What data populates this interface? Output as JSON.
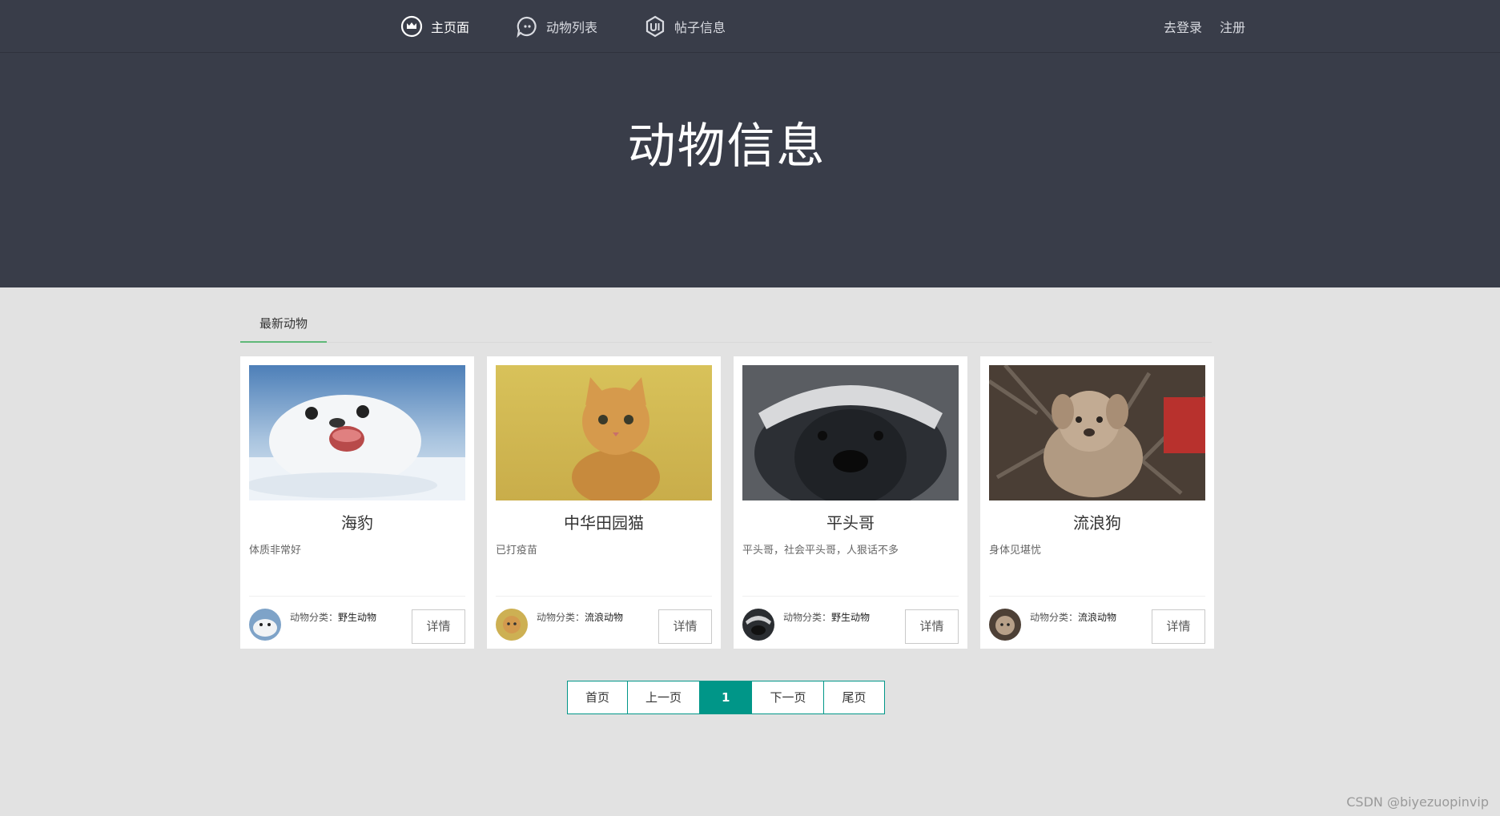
{
  "nav": {
    "items": [
      {
        "label": "主页面",
        "icon": "crown-icon",
        "active": true
      },
      {
        "label": "动物列表",
        "icon": "chat-icon",
        "active": false
      },
      {
        "label": "帖子信息",
        "icon": "ui-badge-icon",
        "active": false
      }
    ],
    "login_label": "去登录",
    "register_label": "注册"
  },
  "banner": {
    "title": "动物信息"
  },
  "section": {
    "tab_label": "最新动物"
  },
  "cards": [
    {
      "name": "海豹",
      "desc": "体质非常好",
      "category_prefix": "动物分类：",
      "category": "野生动物",
      "detail_label": "详情",
      "image": "seal-photo"
    },
    {
      "name": "中华田园猫",
      "desc": "已打疫苗",
      "category_prefix": "动物分类：",
      "category": "流浪动物",
      "detail_label": "详情",
      "image": "kitten-photo"
    },
    {
      "name": "平头哥",
      "desc": "平头哥，社会平头哥，人狠话不多",
      "category_prefix": "动物分类：",
      "category": "野生动物",
      "detail_label": "详情",
      "image": "honey-badger-photo"
    },
    {
      "name": "流浪狗",
      "desc": "身体见堪忧",
      "category_prefix": "动物分类：",
      "category": "流浪动物",
      "detail_label": "详情",
      "image": "stray-dog-photo"
    }
  ],
  "pagination": {
    "first": "首页",
    "prev": "上一页",
    "current": "1",
    "next": "下一页",
    "last": "尾页"
  },
  "watermark": "CSDN @biyezuopinvip",
  "colors": {
    "header_bg": "#393d49",
    "page_bg": "#e2e2e2",
    "accent_green": "#5fb878",
    "pager_teal": "#009688"
  }
}
